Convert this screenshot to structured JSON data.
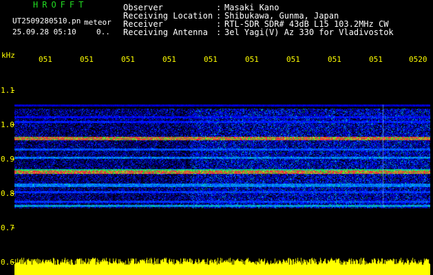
{
  "header": {
    "app_title": "HROFFT",
    "file_name": "UT2509280510.pn",
    "mode_label": "meteor",
    "date_time": "25.09.28 05:10",
    "count": "0..",
    "info": [
      {
        "label": "Observer",
        "value": "Masaki Kano"
      },
      {
        "label": "Receiving Location",
        "value": "Shibukawa, Gunma, Japan"
      },
      {
        "label": "Receiver",
        "value": "RTL-SDR SDR# 43dB L15 103.2MHz CW"
      },
      {
        "label": "Receiving Antenna",
        "value": "3el Yagi(V) Az 330 for Vladivostok"
      }
    ],
    "separator": ":"
  },
  "axis": {
    "unit": "kHz",
    "time_labels": [
      "051",
      "051",
      "051",
      "051",
      "051",
      "051",
      "051",
      "051",
      "051",
      "0520"
    ],
    "freq_labels": [
      "1.1",
      "1.0",
      "0.9",
      "0.8",
      "0.7",
      "0.6"
    ]
  },
  "colors": {
    "background": "#000000",
    "header_text": "#ffffff",
    "title": "#22dd22",
    "axis": "#ffff00",
    "echo_line": "#ff3030",
    "noise_floor": "#1030c0",
    "level_bar": "#ffff00"
  }
}
